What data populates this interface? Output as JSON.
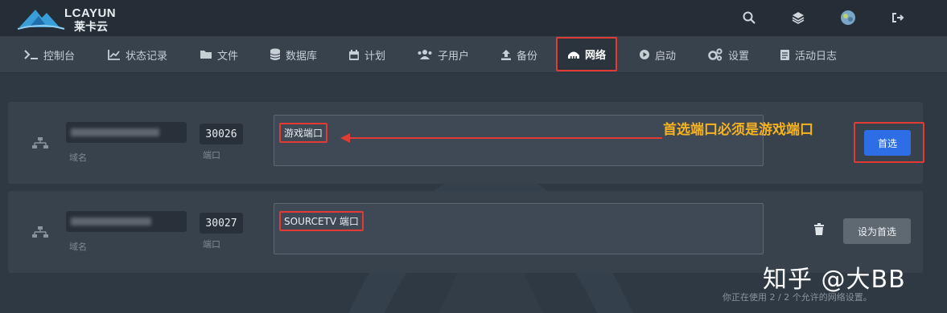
{
  "brand": {
    "name": "LCAYUN",
    "subtitle": "莱卡云"
  },
  "topbar": {
    "icons": [
      "search-icon",
      "layers-icon",
      "avatar",
      "logout-icon"
    ]
  },
  "nav": {
    "items": [
      {
        "label": "控制台",
        "icon": "terminal-icon"
      },
      {
        "label": "状态记录",
        "icon": "chart-icon"
      },
      {
        "label": "文件",
        "icon": "folder-icon"
      },
      {
        "label": "数据库",
        "icon": "database-icon"
      },
      {
        "label": "计划",
        "icon": "calendar-icon"
      },
      {
        "label": "子用户",
        "icon": "users-icon"
      },
      {
        "label": "备份",
        "icon": "upload-icon"
      },
      {
        "label": "网络",
        "icon": "network-icon",
        "active": true
      },
      {
        "label": "启动",
        "icon": "play-icon"
      },
      {
        "label": "设置",
        "icon": "cogs-icon"
      },
      {
        "label": "活动日志",
        "icon": "log-icon"
      }
    ]
  },
  "allocations": [
    {
      "domain_label": "域名",
      "port": "30026",
      "port_label": "端口",
      "notes": "游戏端口",
      "button": "首选"
    },
    {
      "domain_label": "域名",
      "port": "30027",
      "port_label": "端口",
      "notes": "SOURCETV 端口",
      "button": "设为首选"
    }
  ],
  "annotation": "首选端口必须是游戏端口",
  "watermark": "知乎 @大BB",
  "footer": "你正在使用 2 / 2 个允许的网络设置。",
  "colors": {
    "accent": "#2d6ee6",
    "highlight": "#e23b36",
    "annotation": "#f7b21f"
  }
}
